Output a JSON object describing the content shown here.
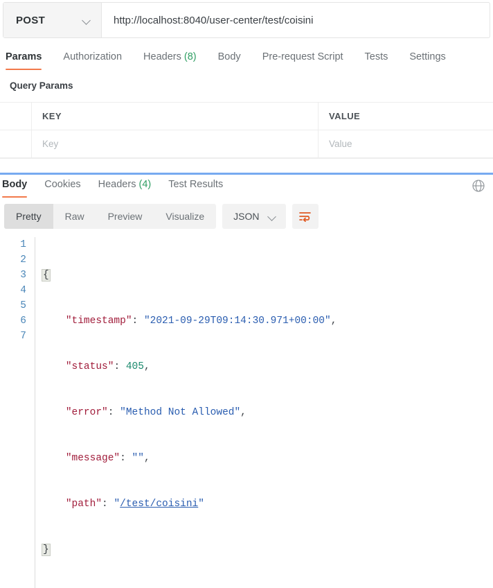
{
  "request": {
    "method": "POST",
    "url": "http://localhost:8040/user-center/test/coisini",
    "method_icon": "chevron-down-icon"
  },
  "request_tabs": [
    {
      "label": "Params",
      "count": "",
      "active": true
    },
    {
      "label": "Authorization",
      "count": "",
      "active": false
    },
    {
      "label": "Headers",
      "count": "(8)",
      "active": false
    },
    {
      "label": "Body",
      "count": "",
      "active": false
    },
    {
      "label": "Pre-request Script",
      "count": "",
      "active": false
    },
    {
      "label": "Tests",
      "count": "",
      "active": false
    },
    {
      "label": "Settings",
      "count": "",
      "active": false
    }
  ],
  "query_params": {
    "title": "Query Params",
    "headers": {
      "key": "KEY",
      "value": "VALUE"
    },
    "rows": [
      {
        "key_placeholder": "Key",
        "value_placeholder": "Value"
      }
    ]
  },
  "response_tabs": [
    {
      "label": "Body",
      "count": "",
      "active": true
    },
    {
      "label": "Cookies",
      "count": "",
      "active": false
    },
    {
      "label": "Headers",
      "count": "(4)",
      "active": false
    },
    {
      "label": "Test Results",
      "count": "",
      "active": false
    }
  ],
  "response_toolbar": {
    "globe_icon": "globe-icon",
    "formats": [
      {
        "label": "Pretty",
        "active": true
      },
      {
        "label": "Raw",
        "active": false
      },
      {
        "label": "Preview",
        "active": false
      },
      {
        "label": "Visualize",
        "active": false
      }
    ],
    "language": "JSON",
    "language_icon": "chevron-down-icon",
    "wrap_icon": "word-wrap-icon"
  },
  "response_body": {
    "line_numbers": [
      "1",
      "2",
      "3",
      "4",
      "5",
      "6",
      "7"
    ],
    "json": {
      "timestamp": "2021-09-29T09:14:30.971+00:00",
      "status": 405,
      "error": "Method Not Allowed",
      "message": "",
      "path": "/test/coisini"
    },
    "tokens": {
      "open_brace": "{",
      "close_brace": "}",
      "k_timestamp": "\"timestamp\"",
      "v_timestamp": "\"2021-09-29T09:14:30.971+00:00\"",
      "k_status": "\"status\"",
      "v_status": "405",
      "k_error": "\"error\"",
      "v_error": "\"Method Not Allowed\"",
      "k_message": "\"message\"",
      "v_message": "\"\"",
      "k_path": "\"path\"",
      "v_path_quote_open": "\"",
      "v_path": "/test/coisini",
      "v_path_quote_close": "\"",
      "colon": ": ",
      "comma": ","
    }
  },
  "colors": {
    "accent": "#f2794a",
    "divider_blue": "#77aaf0",
    "count_green": "#2f9e63",
    "json_key": "#a11d3b",
    "json_string": "#2a5db0",
    "json_number": "#1a8a6d",
    "line_number": "#4a86b8"
  }
}
